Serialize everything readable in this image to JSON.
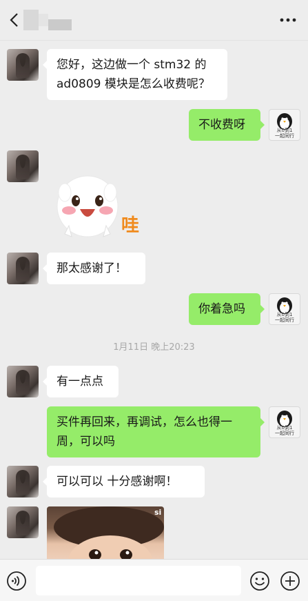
{
  "header": {
    "title_redacted": true
  },
  "messages": [
    {
      "side": "left",
      "text": "您好，这边做一个 stm32 的\nad0809 模块是怎么收费呢？"
    },
    {
      "side": "right",
      "text": "不收费呀"
    },
    {
      "side": "left",
      "type": "sticker",
      "sticker_text": "哇"
    },
    {
      "side": "left",
      "text": "那太感谢了！"
    },
    {
      "side": "right",
      "text": "你着急吗"
    },
    {
      "side": "left",
      "text": "有一点点"
    },
    {
      "side": "right",
      "text": "买件再回来，再调试，怎么也得一\n周，可以吗"
    },
    {
      "side": "left",
      "text": "可以可以  十分感谢啊！"
    },
    {
      "side": "left",
      "type": "image",
      "image_text": "si"
    }
  ],
  "timestamp": "1月11日 晚上20:23",
  "right_avatar": {
    "caption_line1": "从0到1",
    "caption_line2": "一起同行"
  },
  "colors": {
    "background": "#ededed",
    "bubble_right": "#95ec69",
    "bubble_left": "#ffffff"
  },
  "footer": {
    "icons": [
      "voice-icon",
      "emoji-icon",
      "plus-icon"
    ]
  }
}
